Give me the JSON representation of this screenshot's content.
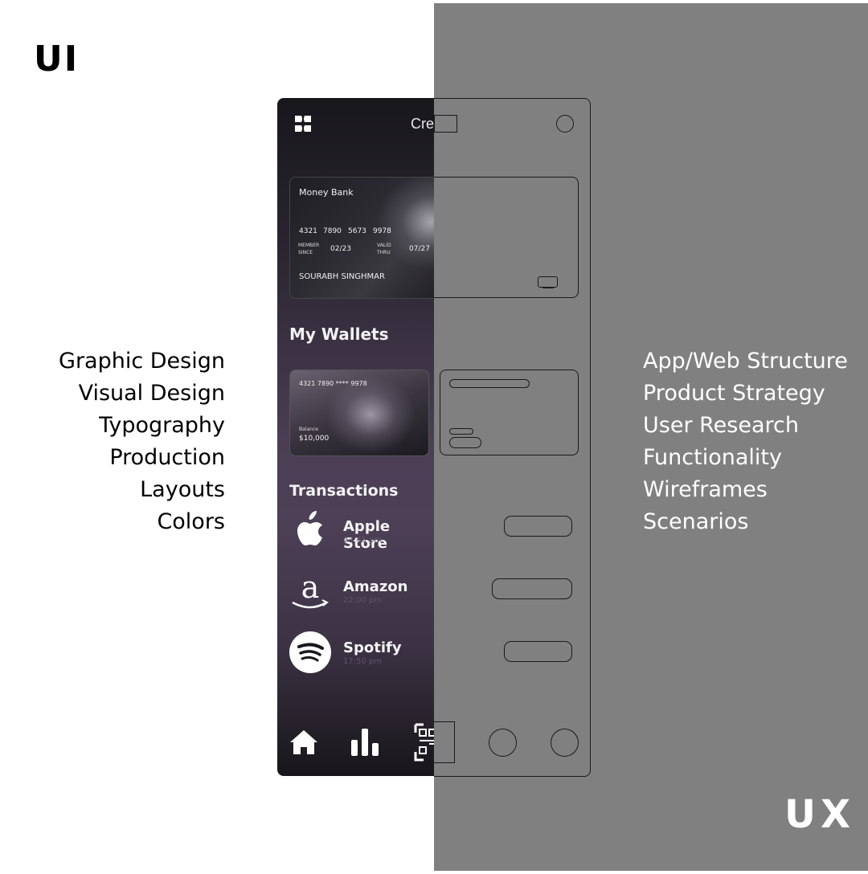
{
  "labels": {
    "ui": "UI",
    "ux": "UX"
  },
  "ui_skills": [
    "Graphic Design",
    "Visual Design",
    "Typography",
    "Production",
    "Layouts",
    "Colors"
  ],
  "ux_skills": [
    "App/Web Structure",
    "Product Strategy",
    "User Research",
    "Functionality",
    "Wireframes",
    "Scenarios"
  ],
  "app": {
    "header_title": "Cre",
    "card": {
      "bank": "Money Bank",
      "number_groups": [
        "4321",
        "7890",
        "5673",
        "9978"
      ],
      "member_since_label": "MEMBER SINCE",
      "member_since": "02/23",
      "valid_thru_label": "VALID THRU",
      "valid_thru": "07/27",
      "holder": "SOURABH SINGHMAR"
    },
    "wallets_title": "My Wallets",
    "wallet": {
      "number": "4321 7890 **** 9978",
      "balance_label": "Balance",
      "balance": "$10,000"
    },
    "transactions_title": "Transactions",
    "transactions": [
      {
        "name": "Apple Store",
        "time": "23:45 pm",
        "icon": "apple-icon"
      },
      {
        "name": "Amazon",
        "time": "22:00 pm",
        "icon": "amazon-icon"
      },
      {
        "name": "Spotify",
        "time": "17:50 pm",
        "icon": "spotify-icon"
      }
    ],
    "nav": [
      "home-icon",
      "stats-icon",
      "qr-scan-icon"
    ]
  },
  "colors": {
    "ux_background": "#808080",
    "ui_text": "#000000",
    "ux_text": "#ffffff"
  }
}
